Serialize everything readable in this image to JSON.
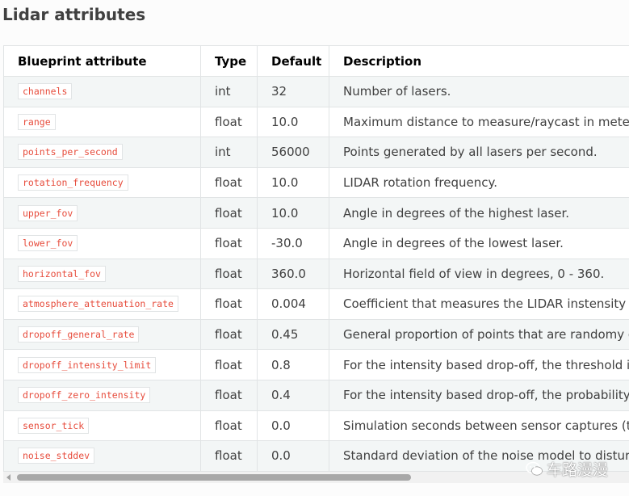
{
  "title": "Lidar attributes",
  "table": {
    "headers": [
      "Blueprint attribute",
      "Type",
      "Default",
      "Description"
    ],
    "rows": [
      {
        "attr": "channels",
        "type": "int",
        "default": "32",
        "desc": "Number of lasers."
      },
      {
        "attr": "range",
        "type": "float",
        "default": "10.0",
        "desc": "Maximum distance to measure/raycast in meters ("
      },
      {
        "attr": "points_per_second",
        "type": "int",
        "default": "56000",
        "desc": "Points generated by all lasers per second."
      },
      {
        "attr": "rotation_frequency",
        "type": "float",
        "default": "10.0",
        "desc": "LIDAR rotation frequency."
      },
      {
        "attr": "upper_fov",
        "type": "float",
        "default": "10.0",
        "desc": "Angle in degrees of the highest laser."
      },
      {
        "attr": "lower_fov",
        "type": "float",
        "default": "-30.0",
        "desc": "Angle in degrees of the lowest laser."
      },
      {
        "attr": "horizontal_fov",
        "type": "float",
        "default": "360.0",
        "desc": "Horizontal field of view in degrees, 0 - 360."
      },
      {
        "attr": "atmosphere_attenuation_rate",
        "type": "float",
        "default": "0.004",
        "desc": "Coefficient that measures the LIDAR instensity los"
      },
      {
        "attr": "dropoff_general_rate",
        "type": "float",
        "default": "0.45",
        "desc": "General proportion of points that are randomy dro"
      },
      {
        "attr": "dropoff_intensity_limit",
        "type": "float",
        "default": "0.8",
        "desc": "For the intensity based drop-off, the threshold inte"
      },
      {
        "attr": "dropoff_zero_intensity",
        "type": "float",
        "default": "0.4",
        "desc": "For the intensity based drop-off, the probability of"
      },
      {
        "attr": "sensor_tick",
        "type": "float",
        "default": "0.0",
        "desc": "Simulation seconds between sensor captures (tick"
      },
      {
        "attr": "noise_stddev",
        "type": "float",
        "default": "0.0",
        "desc": "Standard deviation of the noise model to disturb e"
      }
    ]
  },
  "watermark": {
    "text": "车路漫漫",
    "icon": "wechat-icon"
  },
  "colors": {
    "code_text": "#e74c3c",
    "row_alt": "#f3f6f6",
    "border": "#e1e4e5"
  }
}
